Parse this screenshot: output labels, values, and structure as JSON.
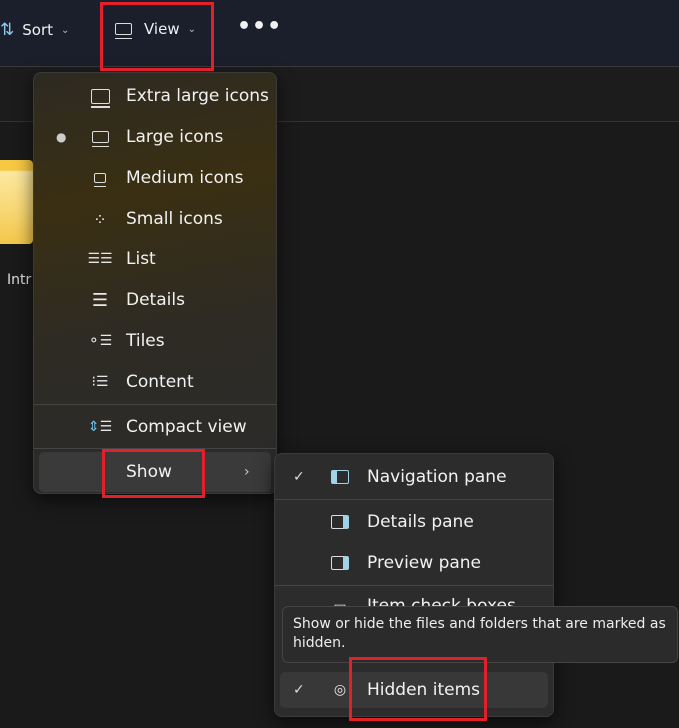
{
  "toolbar": {
    "sort_label": "Sort",
    "view_label": "View",
    "more_icon": "more-icon"
  },
  "content": {
    "folder_label": "Intr"
  },
  "view_menu": {
    "items": [
      {
        "label": "Extra large icons",
        "icon": "extra-large-icons-icon"
      },
      {
        "label": "Large icons",
        "icon": "large-icons-icon",
        "selected": true
      },
      {
        "label": "Medium icons",
        "icon": "medium-icons-icon"
      },
      {
        "label": "Small icons",
        "icon": "small-icons-icon"
      },
      {
        "label": "List",
        "icon": "list-icon"
      },
      {
        "label": "Details",
        "icon": "details-icon"
      },
      {
        "label": "Tiles",
        "icon": "tiles-icon"
      },
      {
        "label": "Content",
        "icon": "content-icon"
      },
      {
        "label": "Compact view",
        "icon": "compact-view-icon"
      },
      {
        "label": "Show",
        "icon": "chevron-right-icon"
      }
    ]
  },
  "show_menu": {
    "items": [
      {
        "label": "Navigation pane",
        "checked": true
      },
      {
        "label": "Details pane",
        "checked": false
      },
      {
        "label": "Preview pane",
        "checked": false
      },
      {
        "label": "Item check boxes",
        "checked": false
      },
      {
        "label": "Hidden items",
        "checked": true
      }
    ]
  },
  "tooltip": {
    "text": "Show or hide the files and folders that are marked as hidden."
  },
  "colors": {
    "highlight_box": "#e0202a",
    "accent": "#9fd3e8"
  }
}
